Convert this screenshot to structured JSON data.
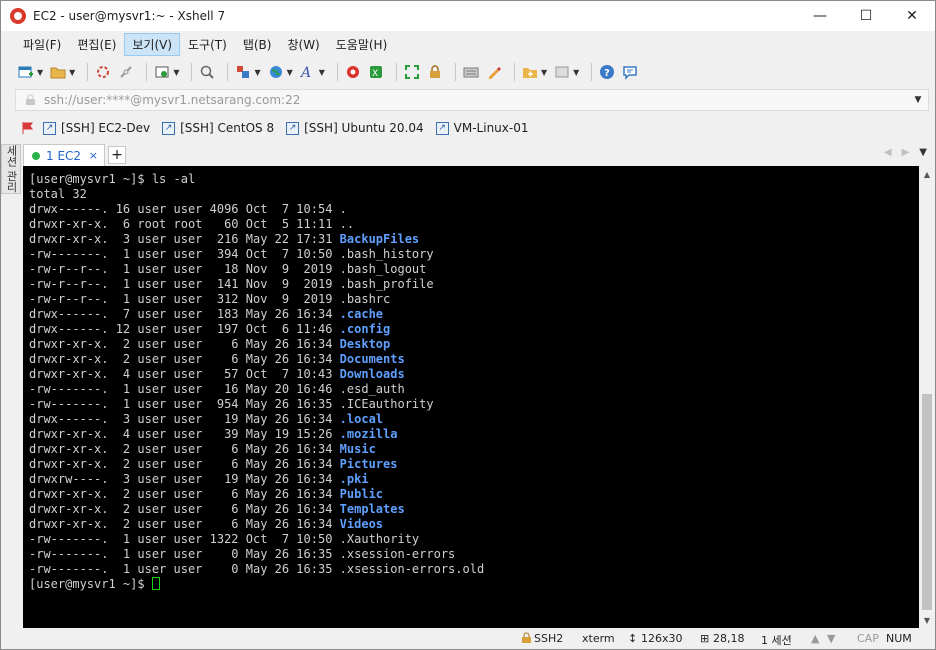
{
  "window": {
    "title": "EC2 - user@mysvr1:~ - Xshell 7",
    "minimize_glyph": "—",
    "maximize_glyph": "☐",
    "close_glyph": "✕"
  },
  "menu": [
    "파일(F)",
    "편집(E)",
    "보기(V)",
    "도구(T)",
    "탭(B)",
    "창(W)",
    "도움말(H)"
  ],
  "toolbar": {
    "icons": [
      "new-session-icon",
      "open-folder-icon",
      "connect-icon",
      "disconnect-icon",
      "properties-icon",
      "search-icon",
      "transfer-icon",
      "globe-icon",
      "font-icon",
      "xftp-icon",
      "xmanager-icon",
      "fullscreen-icon",
      "lock-icon",
      "keyboard-icon",
      "highlight-icon",
      "add-tab-icon",
      "layout-icon",
      "help-icon",
      "chat-icon"
    ]
  },
  "address": {
    "value": "ssh://user:****@mysvr1.netsarang.com:22"
  },
  "links": [
    {
      "label": "[SSH] EC2-Dev"
    },
    {
      "label": "[SSH] CentOS 8"
    },
    {
      "label": "[SSH] Ubuntu 20.04"
    },
    {
      "label": "VM-Linux-01"
    }
  ],
  "side_panel": {
    "label": "세션 관리"
  },
  "tabs": [
    {
      "label": "1 EC2",
      "close": "×"
    }
  ],
  "tab_add": "+",
  "terminal": {
    "prompt_line": "[user@mysvr1 ~]$ ls -al",
    "total_line": "total 32",
    "entries": [
      {
        "meta": "drwx------. 16 user user 4096 Oct  7 10:54 ",
        "name": ".",
        "dir": false
      },
      {
        "meta": "drwxr-xr-x.  6 root root   60 Oct  5 11:11 ",
        "name": "..",
        "dir": false
      },
      {
        "meta": "drwxr-xr-x.  3 user user  216 May 22 17:31 ",
        "name": "BackupFiles",
        "dir": true
      },
      {
        "meta": "-rw-------.  1 user user  394 Oct  7 10:50 ",
        "name": ".bash_history",
        "dir": false
      },
      {
        "meta": "-rw-r--r--.  1 user user   18 Nov  9  2019 ",
        "name": ".bash_logout",
        "dir": false
      },
      {
        "meta": "-rw-r--r--.  1 user user  141 Nov  9  2019 ",
        "name": ".bash_profile",
        "dir": false
      },
      {
        "meta": "-rw-r--r--.  1 user user  312 Nov  9  2019 ",
        "name": ".bashrc",
        "dir": false
      },
      {
        "meta": "drwx------.  7 user user  183 May 26 16:34 ",
        "name": ".cache",
        "dir": true
      },
      {
        "meta": "drwx------. 12 user user  197 Oct  6 11:46 ",
        "name": ".config",
        "dir": true
      },
      {
        "meta": "drwxr-xr-x.  2 user user    6 May 26 16:34 ",
        "name": "Desktop",
        "dir": true
      },
      {
        "meta": "drwxr-xr-x.  2 user user    6 May 26 16:34 ",
        "name": "Documents",
        "dir": true
      },
      {
        "meta": "drwxr-xr-x.  4 user user   57 Oct  7 10:43 ",
        "name": "Downloads",
        "dir": true
      },
      {
        "meta": "-rw-------.  1 user user   16 May 20 16:46 ",
        "name": ".esd_auth",
        "dir": false
      },
      {
        "meta": "-rw-------.  1 user user  954 May 26 16:35 ",
        "name": ".ICEauthority",
        "dir": false
      },
      {
        "meta": "drwx------.  3 user user   19 May 26 16:34 ",
        "name": ".local",
        "dir": true
      },
      {
        "meta": "drwxr-xr-x.  4 user user   39 May 19 15:26 ",
        "name": ".mozilla",
        "dir": true
      },
      {
        "meta": "drwxr-xr-x.  2 user user    6 May 26 16:34 ",
        "name": "Music",
        "dir": true
      },
      {
        "meta": "drwxr-xr-x.  2 user user    6 May 26 16:34 ",
        "name": "Pictures",
        "dir": true
      },
      {
        "meta": "drwxrw----.  3 user user   19 May 26 16:34 ",
        "name": ".pki",
        "dir": true
      },
      {
        "meta": "drwxr-xr-x.  2 user user    6 May 26 16:34 ",
        "name": "Public",
        "dir": true
      },
      {
        "meta": "drwxr-xr-x.  2 user user    6 May 26 16:34 ",
        "name": "Templates",
        "dir": true
      },
      {
        "meta": "drwxr-xr-x.  2 user user    6 May 26 16:34 ",
        "name": "Videos",
        "dir": true
      },
      {
        "meta": "-rw-------.  1 user user 1322 Oct  7 10:50 ",
        "name": ".Xauthority",
        "dir": false
      },
      {
        "meta": "-rw-------.  1 user user    0 May 26 16:35 ",
        "name": ".xsession-errors",
        "dir": false
      },
      {
        "meta": "-rw-------.  1 user user    0 May 26 16:35 ",
        "name": ".xsession-errors.old",
        "dir": false
      }
    ],
    "final_prompt": "[user@mysvr1 ~]$ "
  },
  "status": {
    "protocol": "SSH2",
    "term": "xterm",
    "size": "126x30",
    "cursor_pos": "28,18",
    "sessions": "1 세션",
    "caps": "CAP",
    "num": "NUM"
  },
  "colors": {
    "terminal_bg": "#000000",
    "terminal_fg": "#d0d0d0",
    "dir_color": "#5fa0ff",
    "cursor_color": "#19d419",
    "tab_accent": "#2264c8"
  }
}
